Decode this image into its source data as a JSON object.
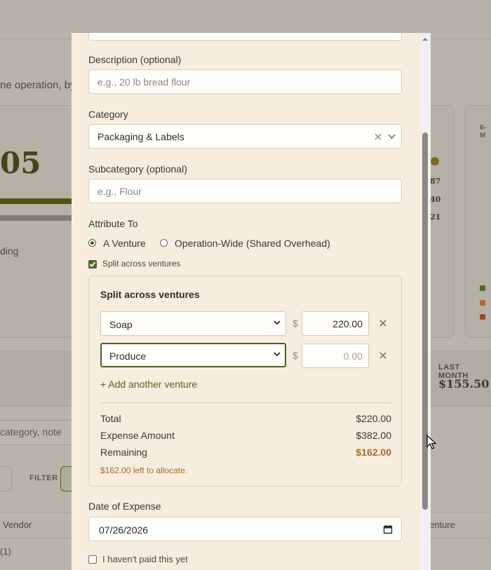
{
  "background": {
    "subtitle_fragment": "ne operation, by",
    "big_number_fragment": "05",
    "pending_fragment": "ding",
    "six_month_fragment": "6-M",
    "chart_values": [
      "87",
      "40",
      "21"
    ],
    "last_month_label": "LAST MONTH",
    "last_month_value": "$155.50",
    "search_placeholder_fragment": "category, note",
    "filter_label": "FILTER",
    "col_vendor": "Vendor",
    "col_venture_fragment": "enture",
    "row_fragment": "(1)"
  },
  "form": {
    "description": {
      "label": "Description (optional)",
      "placeholder": "e.g., 20 lb bread flour"
    },
    "category": {
      "label": "Category",
      "value": "Packaging & Labels"
    },
    "subcategory": {
      "label": "Subcategory (optional)",
      "placeholder": "e.g., Flour"
    },
    "attribute": {
      "label": "Attribute To",
      "options": [
        {
          "label": "A Venture",
          "selected": true
        },
        {
          "label": "Operation-Wide (Shared Overhead)",
          "selected": false
        }
      ]
    },
    "split_checkbox": {
      "label": "Split across ventures",
      "checked": true
    },
    "split": {
      "title": "Split across ventures",
      "rows": [
        {
          "venture": "Soap",
          "currency": "$",
          "amount": "220.00",
          "placeholder": ""
        },
        {
          "venture": "Produce",
          "currency": "$",
          "amount": "",
          "placeholder": "0.00"
        }
      ],
      "add_label": "+ Add another venture",
      "total_label": "Total",
      "total_value": "$220.00",
      "expense_label": "Expense Amount",
      "expense_value": "$382.00",
      "remaining_label": "Remaining",
      "remaining_value": "$162.00",
      "note": "$162.00 left to allocate."
    },
    "date": {
      "label": "Date of Expense",
      "value": "07/26/2026"
    },
    "unpaid": {
      "label": "I haven't paid this yet",
      "checked": false
    }
  },
  "colors": {
    "accent": "#4e5e24",
    "remaining": "#a86a26",
    "modal_bg": "#f6eddf"
  }
}
